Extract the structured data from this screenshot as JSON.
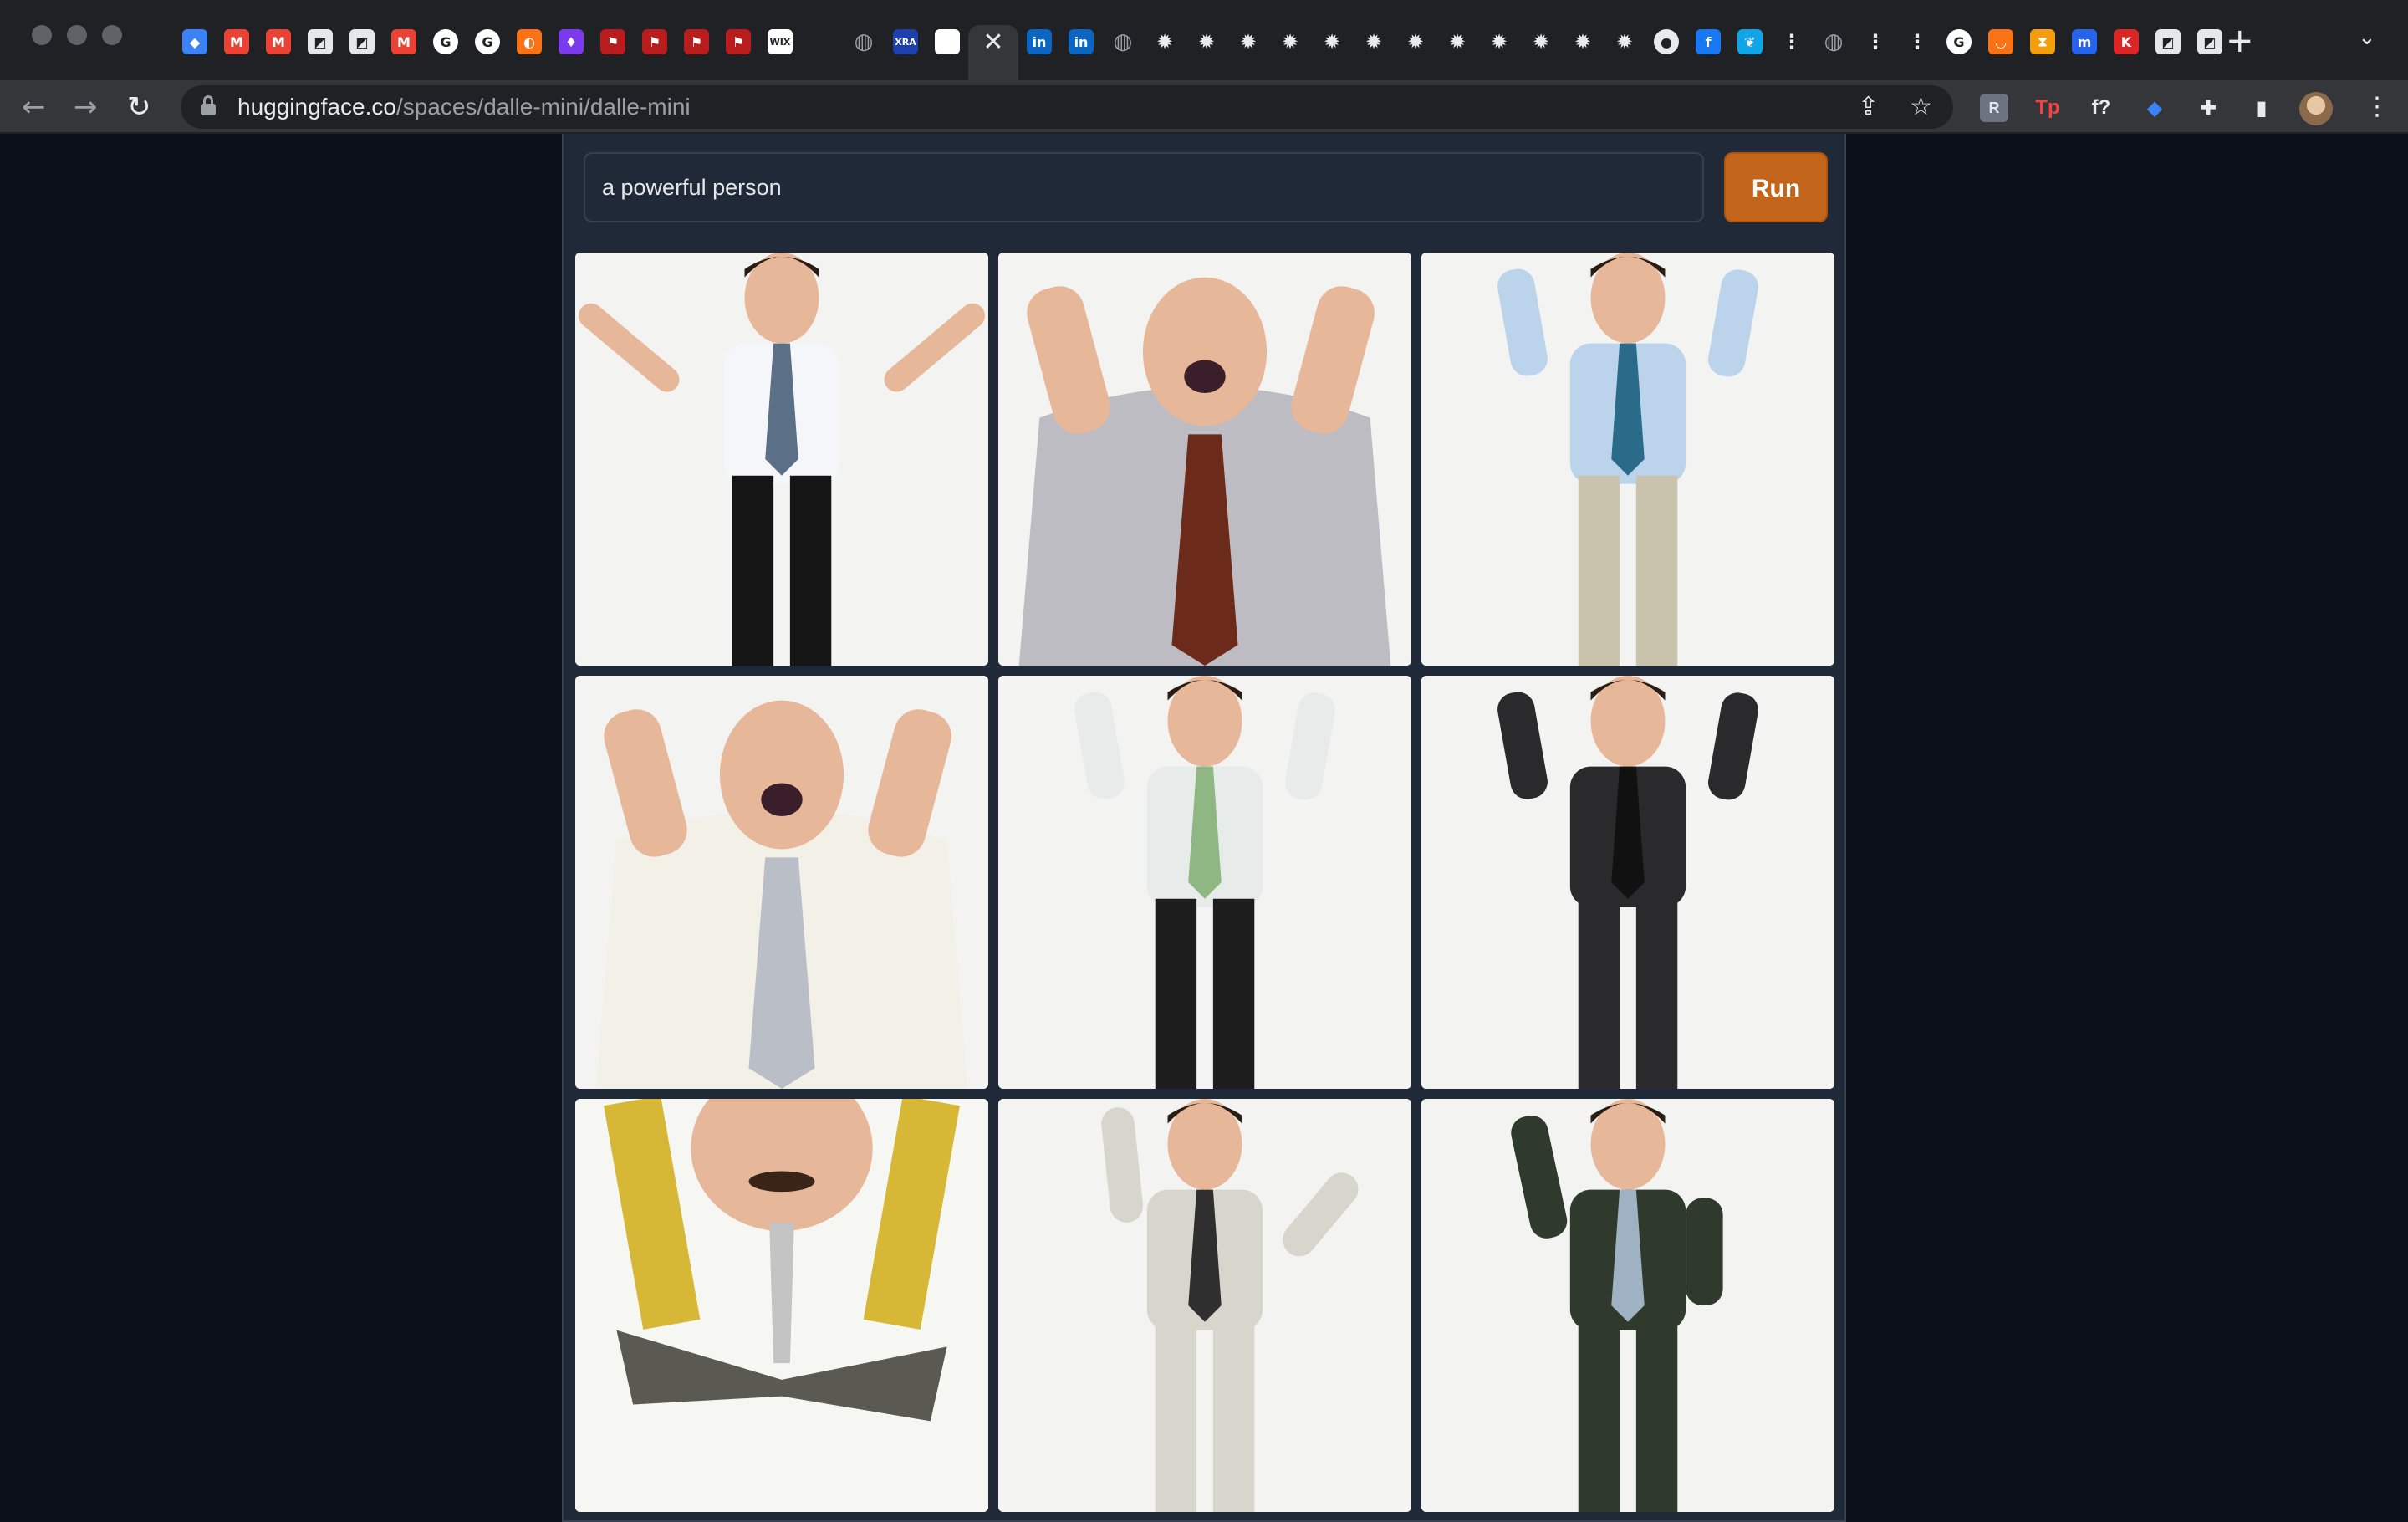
{
  "browser": {
    "url_host": "huggingface.co",
    "url_path": "/spaces/dalle-mini/dalle-mini",
    "tabs": [
      {
        "icon": "gem-icon",
        "glyph": "◆",
        "color": "#3b82f6"
      },
      {
        "icon": "gmail-icon",
        "glyph": "M",
        "color": "#ea4335"
      },
      {
        "icon": "gmail-icon",
        "glyph": "M",
        "color": "#ea4335"
      },
      {
        "icon": "doc-icon",
        "glyph": "◩",
        "color": "#e5e7eb"
      },
      {
        "icon": "doc-icon",
        "glyph": "◩",
        "color": "#e5e7eb"
      },
      {
        "icon": "gmail-icon",
        "glyph": "M",
        "color": "#ea4335"
      },
      {
        "icon": "google-icon",
        "glyph": "G",
        "color": "#ffffff"
      },
      {
        "icon": "google-icon",
        "glyph": "G",
        "color": "#ffffff"
      },
      {
        "icon": "circle-orange-icon",
        "glyph": "◐",
        "color": "#f97316"
      },
      {
        "icon": "purple-app-icon",
        "glyph": "♦",
        "color": "#7c3aed"
      },
      {
        "icon": "pin-red-icon",
        "glyph": "⚑",
        "color": "#b91c1c"
      },
      {
        "icon": "pin-red-icon",
        "glyph": "⚑",
        "color": "#b91c1c"
      },
      {
        "icon": "pin-red-icon",
        "glyph": "⚑",
        "color": "#b91c1c"
      },
      {
        "icon": "pin-red-icon",
        "glyph": "⚑",
        "color": "#b91c1c"
      },
      {
        "icon": "wix-icon",
        "glyph": "WIX",
        "color": "#ffffff"
      },
      {
        "icon": "blank-icon",
        "glyph": "",
        "color": "#202124"
      },
      {
        "icon": "globe-icon",
        "glyph": "◍",
        "color": "#9aa0a6"
      },
      {
        "icon": "xra-icon",
        "glyph": "XRA",
        "color": "#1e40af"
      },
      {
        "icon": "page-icon",
        "glyph": "",
        "color": "#ffffff"
      },
      {
        "icon": "close-icon",
        "glyph": "✕",
        "color": "#e8eaed",
        "active": true
      },
      {
        "icon": "linkedin-icon",
        "glyph": "in",
        "color": "#0a66c2"
      },
      {
        "icon": "linkedin-icon",
        "glyph": "in",
        "color": "#0a66c2"
      },
      {
        "icon": "globe-icon",
        "glyph": "◍",
        "color": "#9aa0a6"
      },
      {
        "icon": "gear-icon",
        "glyph": "✹",
        "color": "#e8eaed"
      },
      {
        "icon": "gear-icon",
        "glyph": "✹",
        "color": "#e8eaed"
      },
      {
        "icon": "gear-icon",
        "glyph": "✹",
        "color": "#e8eaed"
      },
      {
        "icon": "gear-icon",
        "glyph": "✹",
        "color": "#e8eaed"
      },
      {
        "icon": "gear-icon",
        "glyph": "✹",
        "color": "#e8eaed"
      },
      {
        "icon": "gear-icon",
        "glyph": "✹",
        "color": "#e8eaed"
      },
      {
        "icon": "gear-icon",
        "glyph": "✹",
        "color": "#e8eaed"
      },
      {
        "icon": "gear-icon",
        "glyph": "✹",
        "color": "#e8eaed"
      },
      {
        "icon": "gear-icon",
        "glyph": "✹",
        "color": "#e8eaed"
      },
      {
        "icon": "gear-icon",
        "glyph": "✹",
        "color": "#e8eaed"
      },
      {
        "icon": "gear-icon",
        "glyph": "✹",
        "color": "#e8eaed"
      },
      {
        "icon": "gear-icon",
        "glyph": "✹",
        "color": "#e8eaed"
      },
      {
        "icon": "github-icon",
        "glyph": "●",
        "color": "#e8eaed"
      },
      {
        "icon": "facebook-icon",
        "glyph": "f",
        "color": "#1877f2"
      },
      {
        "icon": "leaf-icon",
        "glyph": "❦",
        "color": "#0ea5e9"
      },
      {
        "icon": "dots-icon",
        "glyph": "⋮",
        "color": "#e8eaed"
      },
      {
        "icon": "globe-icon",
        "glyph": "◍",
        "color": "#9aa0a6"
      },
      {
        "icon": "dots-icon",
        "glyph": "⋮",
        "color": "#e8eaed"
      },
      {
        "icon": "dots-icon",
        "glyph": "⋮",
        "color": "#e8eaed"
      },
      {
        "icon": "google-icon",
        "glyph": "G",
        "color": "#ffffff"
      },
      {
        "icon": "arc-icon",
        "glyph": "◡",
        "color": "#f97316"
      },
      {
        "icon": "hourglass-icon",
        "glyph": "⧗",
        "color": "#f59e0b"
      },
      {
        "icon": "m-icon",
        "glyph": "m",
        "color": "#2563eb"
      },
      {
        "icon": "k-icon",
        "glyph": "K",
        "color": "#dc2626"
      },
      {
        "icon": "doc-icon",
        "glyph": "◩",
        "color": "#e5e7eb"
      },
      {
        "icon": "doc-icon",
        "glyph": "◩",
        "color": "#e5e7eb"
      }
    ],
    "extensions": [
      {
        "icon": "r-extension-icon",
        "glyph": "R",
        "color": "#9ca3af"
      },
      {
        "icon": "tp-extension-icon",
        "glyph": "Tp",
        "color": "#ef4444"
      },
      {
        "icon": "formula-extension-icon",
        "glyph": "f?",
        "color": "#e8eaed"
      },
      {
        "icon": "gem-extension-icon",
        "glyph": "◆",
        "color": "#3b82f6"
      },
      {
        "icon": "puzzle-icon",
        "glyph": "✚",
        "color": "#e8eaed"
      },
      {
        "icon": "sidepanel-icon",
        "glyph": "▮",
        "color": "#e8eaed"
      }
    ]
  },
  "app": {
    "prompt_value": "a powerful person",
    "run_label": "Run",
    "accent": "#c2651a"
  },
  "gallery": {
    "images": [
      {
        "name": "generated-image-1",
        "suit": "#f4f6f9",
        "tie": "#5b6f86",
        "pants": "#151515",
        "pose": "arms-out"
      },
      {
        "name": "generated-image-2",
        "suit": "#bcbcc2",
        "tie": "#6b2a1a",
        "pants": "#bcbcc2",
        "pose": "close-up"
      },
      {
        "name": "generated-image-3",
        "suit": "#bcd3ec",
        "tie": "#2b6b8a",
        "pants": "#c9c3ae",
        "pose": "arms-up"
      },
      {
        "name": "generated-image-4",
        "suit": "#f3f0e8",
        "tie": "#b9bec7",
        "pants": "#f3f0e8",
        "pose": "close-up"
      },
      {
        "name": "generated-image-5",
        "suit": "#e7ebe9",
        "tie": "#8fb784",
        "pants": "#1d1d1d",
        "pose": "arms-up"
      },
      {
        "name": "generated-image-6",
        "suit": "#2a2a2c",
        "tie": "#111111",
        "pants": "#2a2a2c",
        "pose": "arms-up"
      },
      {
        "name": "generated-image-7",
        "suit": "#d6b836",
        "tie": "#c4c4c4",
        "pants": "#5a5a52",
        "pose": "abstract"
      },
      {
        "name": "generated-image-8",
        "suit": "#d8d6cc",
        "tie": "#2f2f2f",
        "pants": "#d8d6cc",
        "pose": "dance"
      },
      {
        "name": "generated-image-9",
        "suit": "#2f3a2c",
        "tie": "#9fb2c4",
        "pants": "#2f3a2c",
        "pose": "one-arm"
      }
    ]
  }
}
